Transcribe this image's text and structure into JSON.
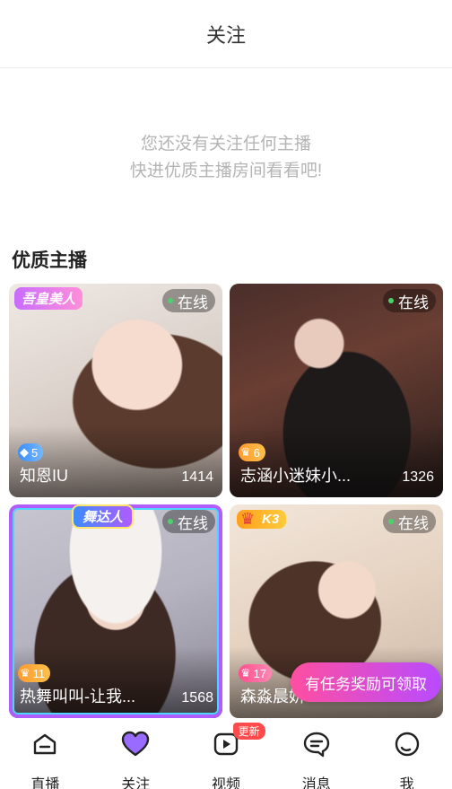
{
  "header": {
    "title": "关注"
  },
  "empty_state": {
    "line1": "您还没有关注任何主播",
    "line2": "快进优质主播房间看看吧!"
  },
  "section": {
    "title": "优质主播"
  },
  "cards": [
    {
      "status": "在线",
      "badge": "吾皇美人",
      "level": "5",
      "level_icon": "diamond-icon",
      "name": "知恩IU",
      "count": "1414"
    },
    {
      "status": "在线",
      "badge": "",
      "level": "6",
      "level_icon": "crown-icon",
      "name": "志涵小迷妹小...",
      "count": "1326"
    },
    {
      "status": "在线",
      "badge": "舞达人",
      "level": "11",
      "level_icon": "crown-icon",
      "name": "热舞叫叫-让我...",
      "count": "1568"
    },
    {
      "status": "在线",
      "badge": "K3",
      "level": "17",
      "level_icon": "crown-icon",
      "name": "森淼晨妍",
      "count": ""
    }
  ],
  "task_pill": {
    "label": "有任务奖励可领取"
  },
  "tabbar": {
    "items": [
      {
        "label": "直播",
        "icon": "live-icon"
      },
      {
        "label": "关注",
        "icon": "heart-icon",
        "active": true
      },
      {
        "label": "视频",
        "icon": "video-icon",
        "badge": "更新"
      },
      {
        "label": "消息",
        "icon": "message-icon"
      },
      {
        "label": "我",
        "icon": "profile-icon"
      }
    ]
  },
  "colors": {
    "accent": "#8a5cff",
    "online_dot": "#49d36a",
    "task_pill": "#ff4fa0"
  }
}
